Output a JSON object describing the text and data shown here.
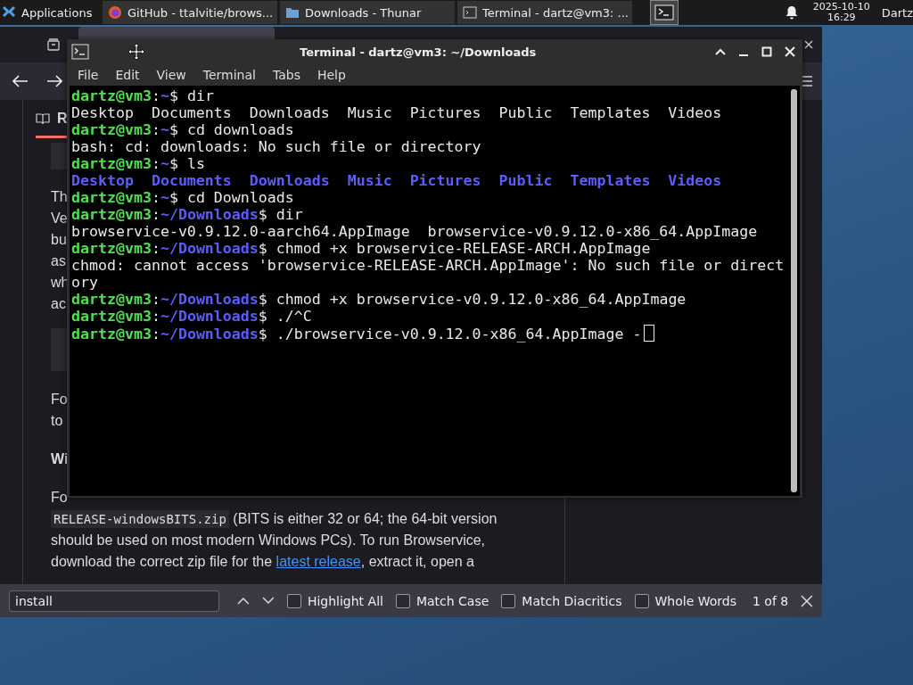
{
  "taskbar": {
    "menu_label": "Applications",
    "windows": [
      {
        "title": "GitHub - ttalvitie/brows...",
        "kind": "browser"
      },
      {
        "title": "Downloads - Thunar",
        "kind": "files"
      },
      {
        "title": "Terminal - dartz@vm3: ...",
        "kind": "terminal"
      }
    ],
    "clock": {
      "date": "2025-10-10",
      "time": "16:29"
    },
    "user": "Dartz"
  },
  "browser": {
    "tab_fragment": "R",
    "article": {
      "cut_lines_1": [
        "Th",
        "Ve",
        "bu",
        "as",
        "wh",
        "ac"
      ],
      "cut_lines_2": [
        "Fo",
        "to"
      ],
      "heading": "Wi",
      "paragraph": [
        [
          {
            "kind": "text",
            "text": "Fo"
          }
        ],
        [
          {
            "kind": "code",
            "text": "RELEASE-windowsBITS.zip"
          },
          {
            "kind": "text",
            "text": " (BITS is either 32 or 64; the 64-bit version"
          }
        ],
        [
          {
            "kind": "text",
            "text": "should be used on most modern Windows PCs). To run Browservice,"
          }
        ],
        [
          {
            "kind": "text",
            "text": "download the correct zip file for the "
          },
          {
            "kind": "link",
            "text": "latest release"
          },
          {
            "kind": "text",
            "text": ", extract it, open a"
          }
        ]
      ]
    },
    "find_bar": {
      "value": "install",
      "options": [
        {
          "label": "Highlight All",
          "checked": false
        },
        {
          "label": "Match Case",
          "checked": false
        },
        {
          "label": "Match Diacritics",
          "checked": false
        },
        {
          "label": "Whole Words",
          "checked": false
        }
      ],
      "result": "1 of 8"
    }
  },
  "terminal": {
    "title": "Terminal - dartz@vm3: ~/Downloads",
    "menu": [
      "File",
      "Edit",
      "View",
      "Terminal",
      "Tabs",
      "Help"
    ],
    "lines": [
      [
        {
          "kind": "host",
          "text": "dartz@vm3"
        },
        {
          "kind": "plain",
          "text": ":"
        },
        {
          "kind": "path",
          "text": "~"
        },
        {
          "kind": "plain",
          "text": "$ dir"
        }
      ],
      [
        {
          "kind": "plain",
          "text": "Desktop  Documents  Downloads  Music  Pictures  Public  Templates  Videos"
        }
      ],
      [
        {
          "kind": "host",
          "text": "dartz@vm3"
        },
        {
          "kind": "plain",
          "text": ":"
        },
        {
          "kind": "path",
          "text": "~"
        },
        {
          "kind": "plain",
          "text": "$ cd downloads"
        }
      ],
      [
        {
          "kind": "plain",
          "text": "bash: cd: downloads: No such file or directory"
        }
      ],
      [
        {
          "kind": "host",
          "text": "dartz@vm3"
        },
        {
          "kind": "plain",
          "text": ":"
        },
        {
          "kind": "path",
          "text": "~"
        },
        {
          "kind": "plain",
          "text": "$ ls"
        }
      ],
      [
        {
          "kind": "dir",
          "text": "Desktop  Documents  Downloads  Music  Pictures  Public  Templates  Videos"
        }
      ],
      [
        {
          "kind": "host",
          "text": "dartz@vm3"
        },
        {
          "kind": "plain",
          "text": ":"
        },
        {
          "kind": "path",
          "text": "~"
        },
        {
          "kind": "plain",
          "text": "$ cd Downloads"
        }
      ],
      [
        {
          "kind": "host",
          "text": "dartz@vm3"
        },
        {
          "kind": "plain",
          "text": ":"
        },
        {
          "kind": "path",
          "text": "~/Downloads"
        },
        {
          "kind": "plain",
          "text": "$ dir"
        }
      ],
      [
        {
          "kind": "plain",
          "text": "browservice-v0.9.12.0-aarch64.AppImage  browservice-v0.9.12.0-x86_64.AppImage"
        }
      ],
      [
        {
          "kind": "host",
          "text": "dartz@vm3"
        },
        {
          "kind": "plain",
          "text": ":"
        },
        {
          "kind": "path",
          "text": "~/Downloads"
        },
        {
          "kind": "plain",
          "text": "$ chmod +x browservice-RELEASE-ARCH.AppImage"
        }
      ],
      [
        {
          "kind": "plain",
          "text": "chmod: cannot access 'browservice-RELEASE-ARCH.AppImage': No such file or direct"
        }
      ],
      [
        {
          "kind": "plain",
          "text": "ory"
        }
      ],
      [
        {
          "kind": "host",
          "text": "dartz@vm3"
        },
        {
          "kind": "plain",
          "text": ":"
        },
        {
          "kind": "path",
          "text": "~/Downloads"
        },
        {
          "kind": "plain",
          "text": "$ chmod +x browservice-v0.9.12.0-x86_64.AppImage"
        }
      ],
      [
        {
          "kind": "host",
          "text": "dartz@vm3"
        },
        {
          "kind": "plain",
          "text": ":"
        },
        {
          "kind": "path",
          "text": "~/Downloads"
        },
        {
          "kind": "plain",
          "text": "$ ./^C"
        }
      ],
      [
        {
          "kind": "host",
          "text": "dartz@vm3"
        },
        {
          "kind": "plain",
          "text": ":"
        },
        {
          "kind": "path",
          "text": "~/Downloads"
        },
        {
          "kind": "plain",
          "text": "$ ./browservice-v0.9.12.0-x86_64.AppImage -"
        },
        {
          "kind": "cursor"
        }
      ]
    ]
  }
}
